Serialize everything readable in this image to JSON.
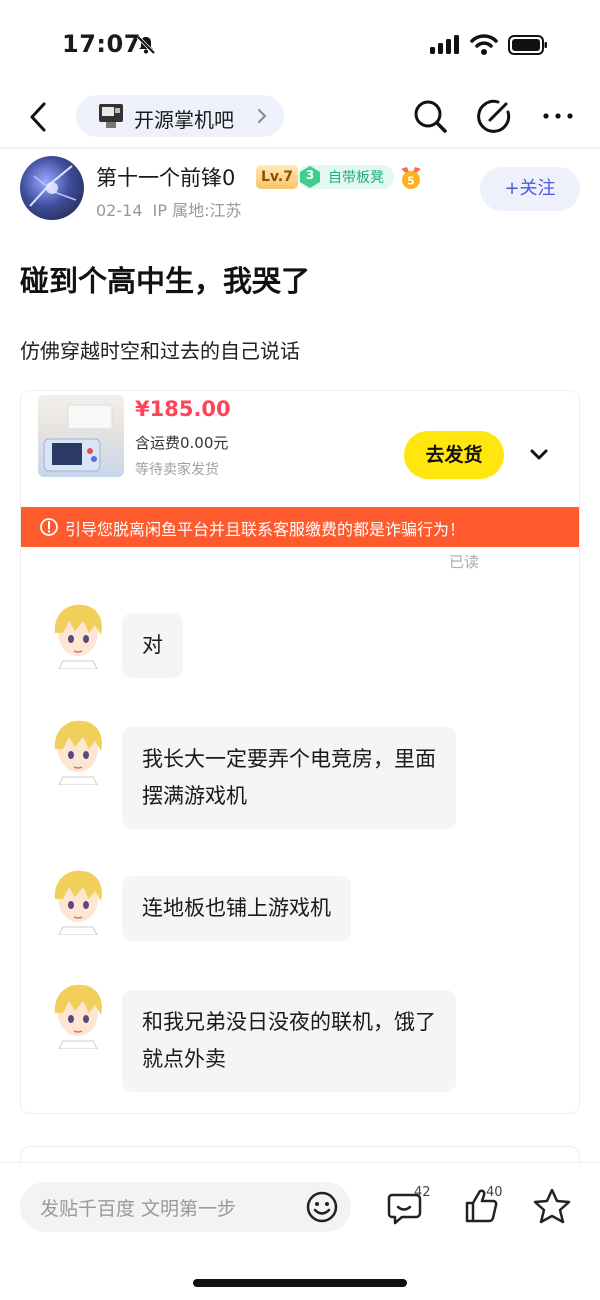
{
  "status_bar": {
    "time": "17:07"
  },
  "nav": {
    "forum_name": "开源掌机吧"
  },
  "author": {
    "name": "第十一个前锋0",
    "level": "Lv.7",
    "tag_number": "3",
    "tag_label": "自带板凳",
    "date": "02-14",
    "location": "IP 属地:江苏",
    "follow_label": "+关注"
  },
  "post": {
    "title": "碰到个高中生，我哭了",
    "text": "仿佛穿越时空和过去的自己说话"
  },
  "order": {
    "price": "¥185.00",
    "shipping": "含运费0.00元",
    "status": "等待卖家发货",
    "ship_button": "去发货"
  },
  "warning": {
    "text": "引导您脱离闲鱼平台并且联系客服缴费的都是诈骗行为！"
  },
  "chat": {
    "read_status": "已读",
    "messages": [
      {
        "line1": "对",
        "line2": ""
      },
      {
        "line1": "我长大一定要弄个电竞房，里面",
        "line2": "摆满游戏机"
      },
      {
        "line1": "连地板也铺上游戏机",
        "line2": ""
      },
      {
        "line1": "和我兄弟没日没夜的联机，饿了",
        "line2": "就点外卖"
      }
    ]
  },
  "bottom_bar": {
    "input_placeholder": "发贴千百度 文明第一步",
    "reply_count": "42",
    "like_count": "40"
  },
  "colors": {
    "price": "#ff4457",
    "warning": "#ff5a2e",
    "ship_button": "#ffe60f",
    "follow_text": "#4a5bd8"
  }
}
